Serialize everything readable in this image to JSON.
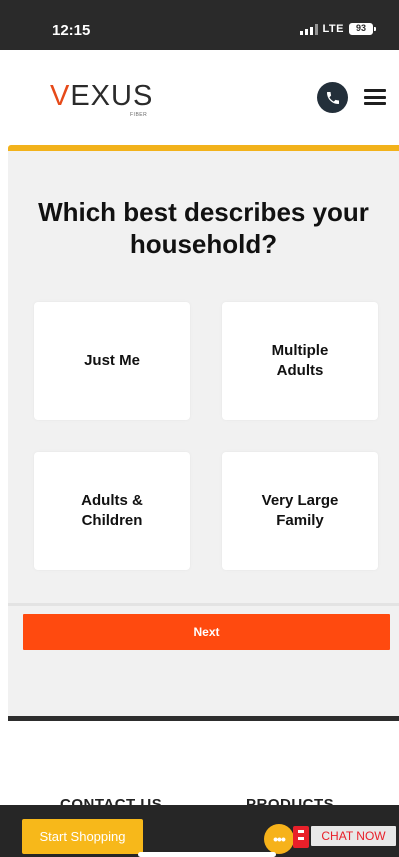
{
  "status_bar": {
    "time": "12:15",
    "network": "LTE",
    "battery": "93"
  },
  "header": {
    "brand_name": "VEXUS",
    "brand_tagline": "FIBER",
    "phone_icon": "phone-icon",
    "menu_icon": "hamburger-menu-icon",
    "accent_color": "#f2b21b"
  },
  "main": {
    "question": "Which best describes your household?",
    "options": [
      "Just Me",
      "Multiple Adults",
      "Adults & Children",
      "Very Large Family"
    ],
    "next_label": "Next",
    "next_color": "#ff4a0f"
  },
  "footer": {
    "contact_heading": "CONTACT US",
    "products_heading": "PRODUCTS"
  },
  "bottom_bar": {
    "start_shopping_label": "Start Shopping",
    "chat_bubble_label": "•••",
    "chat_now_label": "CHAT NOW"
  }
}
